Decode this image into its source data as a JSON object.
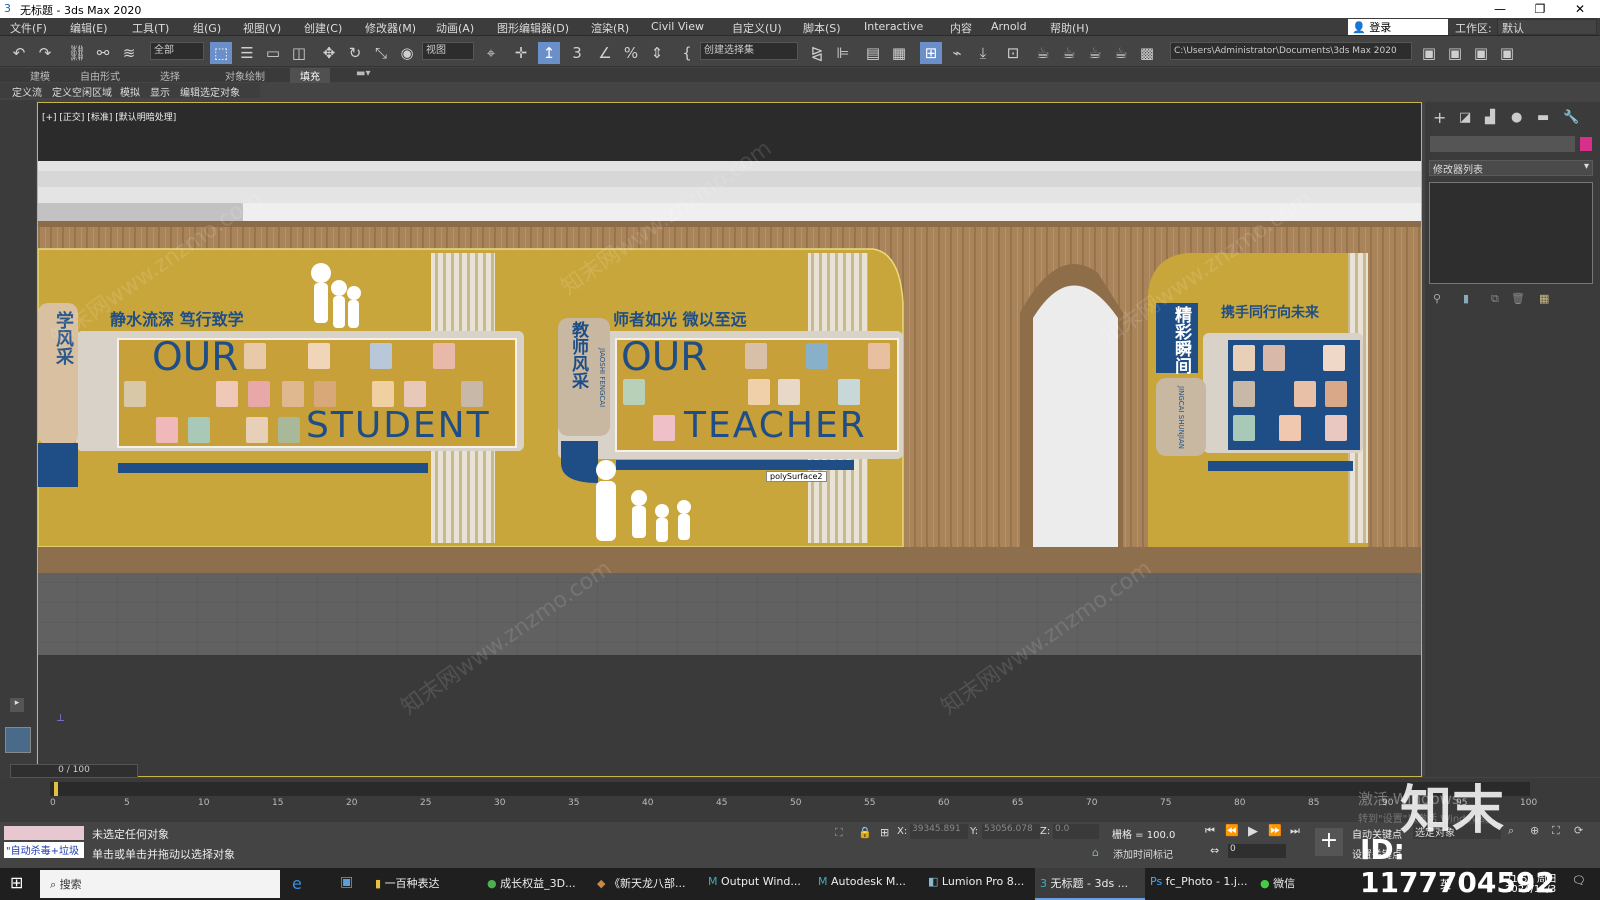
{
  "window": {
    "title": "无标题 - 3ds Max 2020",
    "min": "—",
    "max": "❐",
    "close": "✕"
  },
  "menu": [
    "文件(F)",
    "编辑(E)",
    "工具(T)",
    "组(G)",
    "视图(V)",
    "创建(C)",
    "修改器(M)",
    "动画(A)",
    "图形编辑器(D)",
    "渲染(R)",
    "Civil View",
    "自定义(U)",
    "脚本(S)",
    "Interactive",
    "内容",
    "Arnold",
    "帮助(H)"
  ],
  "account": {
    "login": "登录",
    "workspace_label": "工作区:",
    "workspace_value": "默认"
  },
  "toolbar": {
    "filter": "全部",
    "ref_coord": "视图",
    "selection_set": "创建选择集",
    "path": "C:\\Users\\Administrator\\Documents\\3ds Max 2020"
  },
  "ribbon_tabs": [
    "建模",
    "自由形式",
    "选择",
    "对象绘制",
    "填充"
  ],
  "sub_tabs": [
    "定义流",
    "定义空闲区域",
    "模拟",
    "显示",
    "编辑选定对象"
  ],
  "viewport": {
    "label": "[+] [正交] [标准] [默认明暗处理]",
    "scene": {
      "left_slogan": "静水流深  笃行致学",
      "left_word1": "OUR",
      "left_word2": "STUDENT",
      "mid_badge": "教师风采",
      "mid_badge_pinyin": "JIAOSHI FENGCAI",
      "mid_slogan": "师者如光  微以至远",
      "mid_word1": "OUR",
      "mid_word2": "TEACHER",
      "right_badge": "精彩瞬间",
      "right_badge_pinyin": "JINGCAI SHUNJIAN",
      "right_slogan": "携手同行向未来",
      "left_partial_badge": "学风采",
      "tooltip": "polySurface2"
    }
  },
  "command_panel": {
    "modifier_list": "修改器列表"
  },
  "timeline": {
    "frame": "0 / 100",
    "ticks": [
      "0",
      "5",
      "10",
      "15",
      "20",
      "25",
      "30",
      "35",
      "40",
      "45",
      "50",
      "55",
      "60",
      "65",
      "70",
      "75",
      "80",
      "85",
      "90",
      "95",
      "100"
    ]
  },
  "status": {
    "script_box": "\"自动杀毒+垃圾",
    "line1": "未选定任何对象",
    "line2": "单击或单击并拖动以选择对象",
    "x_label": "X:",
    "x_val": "39345.891",
    "y_label": "Y:",
    "y_val": "53056.078",
    "z_label": "Z:",
    "z_val": "0.0",
    "grid": "栅格 = 100.0",
    "add_time_tag": "添加时间标记",
    "auto_key": "自动关键点",
    "set_key": "设置关键点",
    "selected": "选定对象",
    "key_frame": "0"
  },
  "taskbar": {
    "search": "搜索",
    "items": [
      "一百种表达",
      "成长权益_3D...",
      "《新天龙八部...",
      "Output Wind...",
      "Autodesk M...",
      "Lumion Pro 8...",
      "无标题 - 3ds ...",
      "fc_Photo - 1.j...",
      "微信"
    ],
    "time": "21:56 周日",
    "date": "2024/11/3",
    "ime": "英"
  },
  "overlay": {
    "activate": "激活 Windows",
    "activate_sub": "转到\"设置\"以激活 Windows。",
    "brand": "知末",
    "id": "ID: 1177704592",
    "watermark": "知末网www.znzmo.com"
  },
  "colors": {
    "wall_yellow": "#c9a63c",
    "wood": "#a9845a",
    "navy": "#1f4e86",
    "panel": "#d9d2c8"
  }
}
